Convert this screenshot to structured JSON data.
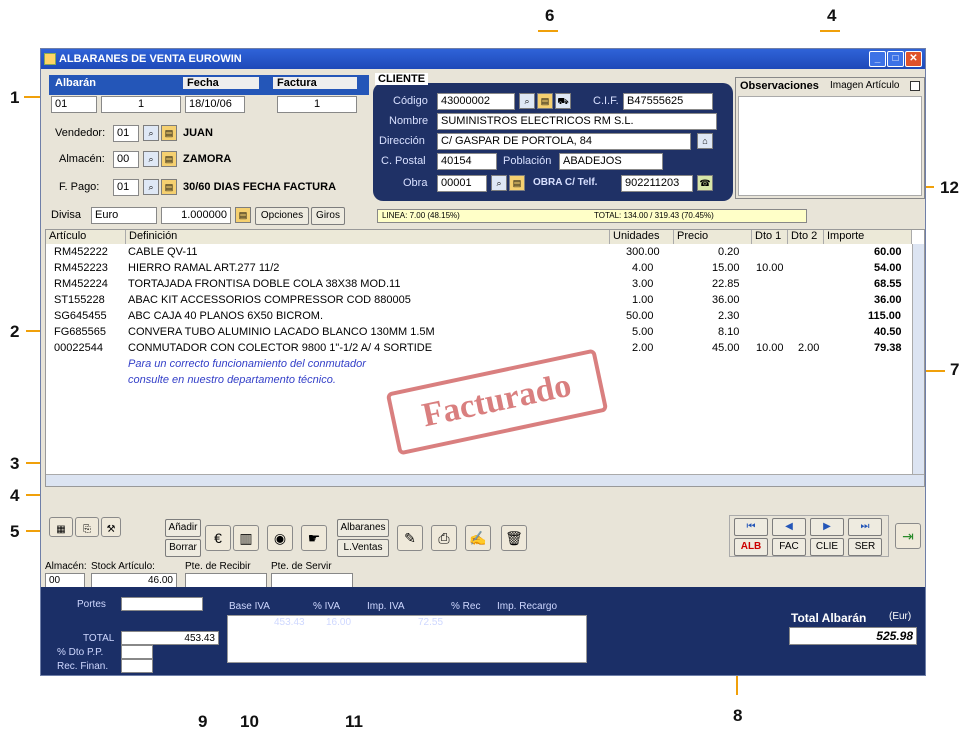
{
  "window": {
    "title": "ALBARANES DE VENTA EUROWIN",
    "icon": "app-icon",
    "controls": [
      "minimize",
      "maximize",
      "close"
    ]
  },
  "callouts": [
    "1",
    "2",
    "3",
    "4",
    "4",
    "5",
    "6",
    "7",
    "8",
    "9",
    "10",
    "11",
    "12"
  ],
  "albaran": {
    "headers": [
      "Albarán",
      "Fecha",
      "Factura"
    ],
    "serie": "01",
    "numero": "1",
    "fecha": "18/10/06",
    "factura": "1",
    "vendedor_label": "Vendedor:",
    "vendedor_code": "01",
    "vendedor_name": "JUAN",
    "almacen_label": "Almacén:",
    "almacen_code": "00",
    "almacen_name": "ZAMORA",
    "pago_label": "F. Pago:",
    "pago_code": "01",
    "pago_name": "30/60 DIAS FECHA FACTURA",
    "divisa_label": "Divisa",
    "divisa": "Euro",
    "cambio": "1.000000",
    "opciones": "Opciones",
    "giros": "Giros"
  },
  "cliente": {
    "title": "CLIENTE",
    "codigo_label": "Código",
    "codigo": "43000002",
    "cif_label": "C.I.F.",
    "cif": "B47555625",
    "nombre_label": "Nombre",
    "nombre": "SUMINISTROS ELECTRICOS RM S.L.",
    "direccion_label": "Dirección",
    "direccion": "C/ GASPAR DE PORTOLA, 84",
    "postal_label": "C. Postal",
    "postal": "40154",
    "poblacion_label": "Población",
    "poblacion": "ABADEJOS",
    "obra_label": "Obra",
    "obra": "00001",
    "obra_name": "OBRA C/ Telf.",
    "telf": "902211203"
  },
  "observaciones": {
    "title": "Observaciones",
    "imagen": "Imagen Artículo"
  },
  "status": {
    "linea": "LINEA: 7.00 (48.15%)",
    "total": "TOTAL: 134.00 / 319.43 (70.45%)"
  },
  "grid": {
    "headers": [
      "Artículo",
      "Definición",
      "Unidades",
      "Precio",
      "Dto 1",
      "Dto 2",
      "Importe"
    ],
    "rows": [
      {
        "art": "RM452222",
        "def": "CABLE QV-11",
        "uds": "300.00",
        "precio": "0.20",
        "d1": "",
        "d2": "",
        "imp": "60.00"
      },
      {
        "art": "RM452223",
        "def": "HIERRO RAMAL ART.277 11/2",
        "uds": "4.00",
        "precio": "15.00",
        "d1": "10.00",
        "d2": "",
        "imp": "54.00"
      },
      {
        "art": "RM452224",
        "def": "TORTAJADA FRONTISA DOBLE COLA 38X38 MOD.11",
        "uds": "3.00",
        "precio": "22.85",
        "d1": "",
        "d2": "",
        "imp": "68.55"
      },
      {
        "art": "ST155228",
        "def": "ABAC KIT ACCESSORIOS COMPRESSOR COD 880005",
        "uds": "1.00",
        "precio": "36.00",
        "d1": "",
        "d2": "",
        "imp": "36.00"
      },
      {
        "art": "SG645455",
        "def": "ABC CAJA 40  PLANOS 6X50 BICROM.",
        "uds": "50.00",
        "precio": "2.30",
        "d1": "",
        "d2": "",
        "imp": "115.00"
      },
      {
        "art": "FG685565",
        "def": "CONVERA TUBO ALUMINIO LACADO BLANCO 130MM 1.5M",
        "uds": "5.00",
        "precio": "8.10",
        "d1": "",
        "d2": "",
        "imp": "40.50"
      },
      {
        "art": "00022544",
        "def": "CONMUTADOR CON COLECTOR 9800  1\"-1/2  A/ 4 SORTIDE",
        "uds": "2.00",
        "precio": "45.00",
        "d1": "10.00",
        "d2": "2.00",
        "imp": "79.38"
      }
    ],
    "note1": "Para un correcto funcionamiento del conmutador",
    "note2": "consulte en nuestro departamento técnico.",
    "stamp": "Facturado"
  },
  "toolbar": {
    "anadir": "Añadir",
    "borrar": "Borrar",
    "albaranes": "Albaranes",
    "lventas": "L.Ventas"
  },
  "nav": {
    "alb": "ALB",
    "fac": "FAC",
    "clie": "CLIE",
    "ser": "SER"
  },
  "stock": {
    "almacen_label": "Almacén:",
    "almacen": "00",
    "stock_label": "Stock Artículo:",
    "stock": "46.00",
    "recibir": "Pte. de Recibir",
    "servir": "Pte. de Servir"
  },
  "totales": {
    "portes": "Portes",
    "total_label": "TOTAL",
    "total": "453.43",
    "dto_label": "% Dto P.P.",
    "rec_label": "Rec. Finan.",
    "headers": [
      "Base IVA",
      "% IVA",
      "Imp. IVA",
      "% Rec",
      "Imp. Recargo"
    ],
    "base": "453.43",
    "iva": "16.00",
    "imp_iva": "72.55",
    "total_albaran_label": "Total Albarán",
    "moneda": "(Eur)",
    "total_albaran": "525.98"
  }
}
